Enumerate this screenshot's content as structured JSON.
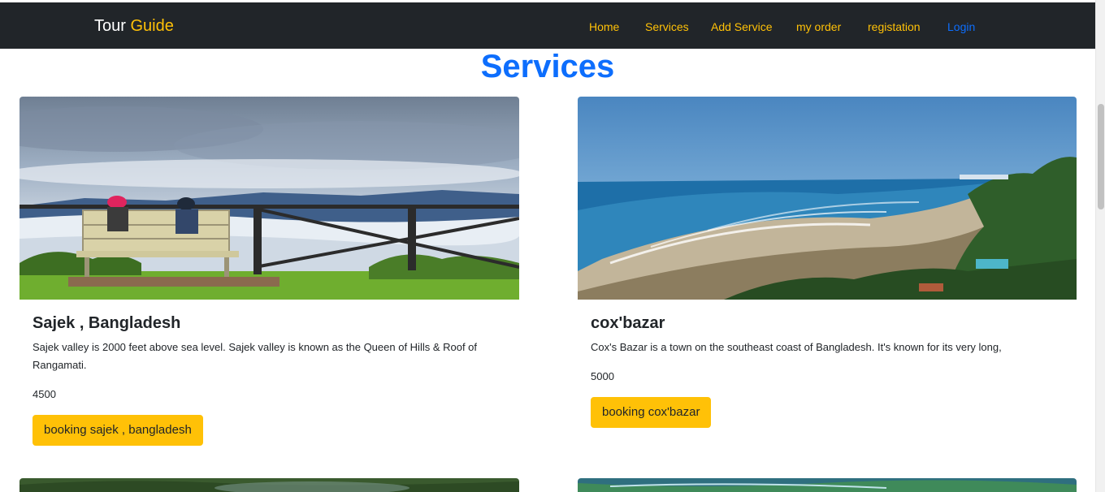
{
  "navbar": {
    "brand_first": "Tour",
    "brand_accent": "Guide",
    "links": [
      {
        "label": "Home"
      },
      {
        "label": "Services"
      },
      {
        "label": "Add Service"
      },
      {
        "label": "my order"
      },
      {
        "label": "registation"
      },
      {
        "label": "Login"
      }
    ]
  },
  "main": {
    "title": "Services",
    "services": [
      {
        "name": "Sajek , Bangladesh",
        "description": "Sajek valley is 2000 feet above sea level. Sajek valley is known as the Queen of Hills & Roof of Rangamati.",
        "price": "4500",
        "button_label": "booking sajek , bangladesh",
        "image": "mountain-valley-bench-photo"
      },
      {
        "name": "cox'bazar",
        "description": "Cox's Bazar is a town on the southeast coast of Bangladesh. It's known for its very long,",
        "price": "5000",
        "button_label": "booking cox'bazar",
        "image": "beach-coastline-photo"
      }
    ]
  },
  "colors": {
    "navbar_bg": "#212529",
    "accent": "#ffc107",
    "primary": "#0d6efd"
  }
}
